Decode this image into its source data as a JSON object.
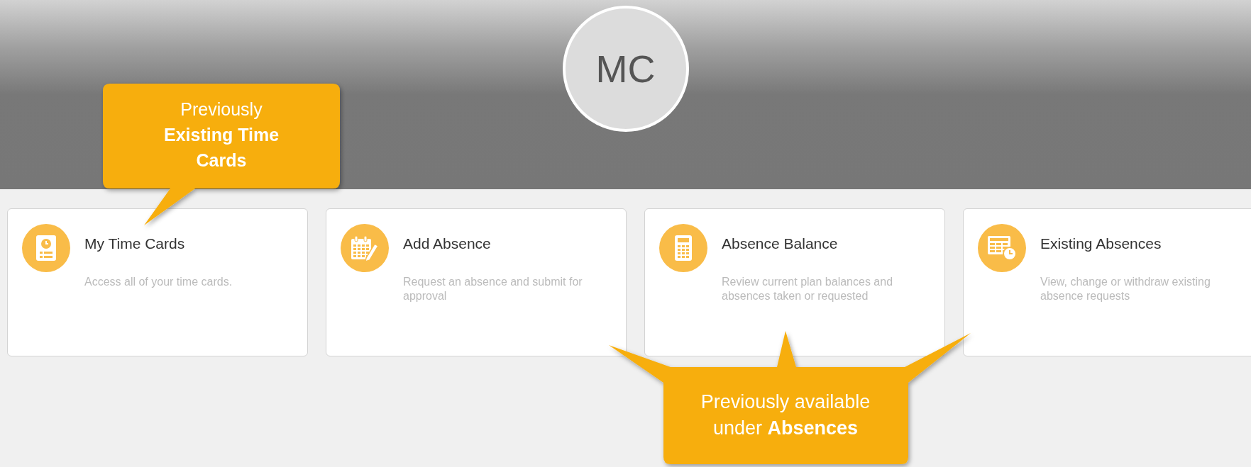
{
  "header": {
    "avatar_initials": "MC"
  },
  "cards": [
    {
      "title": "My Time Cards",
      "description": "Access all of your time cards."
    },
    {
      "title": "Add Absence",
      "description": "Request an absence and submit for approval"
    },
    {
      "title": "Absence Balance",
      "description": "Review current plan balances and absences taken or requested"
    },
    {
      "title": "Existing Absences",
      "description": "View, change or withdraw existing absence requests"
    }
  ],
  "callouts": [
    {
      "text": "Previously **Existing Time Cards**"
    },
    {
      "text": "Previously available under **Absences**"
    }
  ]
}
